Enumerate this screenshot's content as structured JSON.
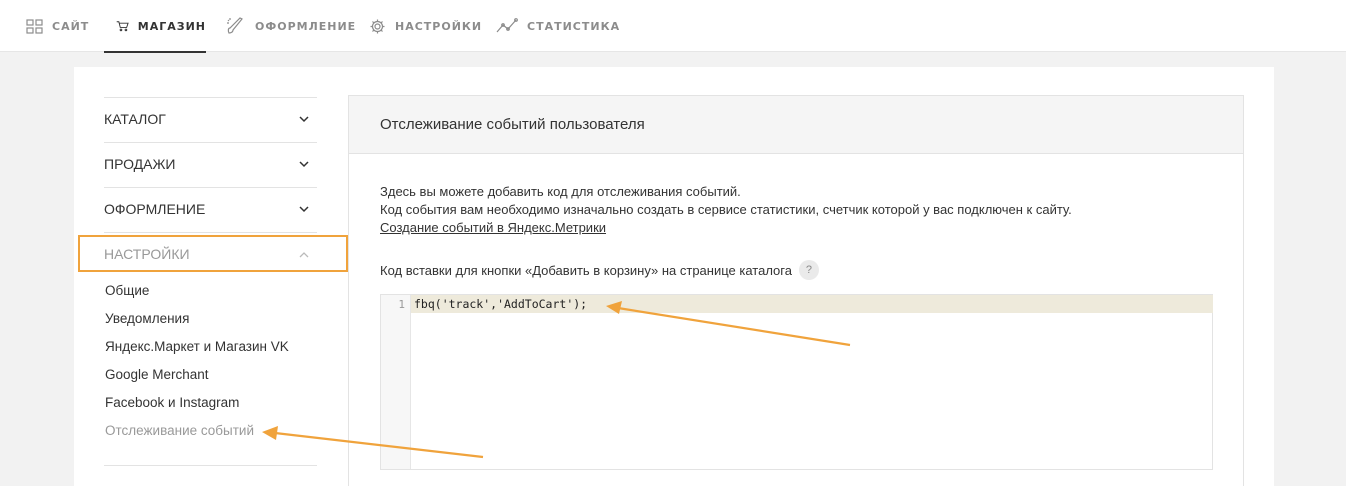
{
  "topnav": {
    "items": [
      {
        "label": "САЙТ",
        "icon": "grid-icon",
        "active": false
      },
      {
        "label": "МАГАЗИН",
        "icon": "cart-icon",
        "active": true
      },
      {
        "label": "ОФОРМЛЕНИЕ",
        "icon": "brush-icon",
        "active": false
      },
      {
        "label": "НАСТРОЙКИ",
        "icon": "gear-icon",
        "active": false
      },
      {
        "label": "СТАТИСТИКА",
        "icon": "chart-line-icon",
        "active": false
      }
    ]
  },
  "sidebar": {
    "sections": [
      {
        "label": "КАТАЛОГ",
        "expanded": false
      },
      {
        "label": "ПРОДАЖИ",
        "expanded": false
      },
      {
        "label": "ОФОРМЛЕНИЕ",
        "expanded": false
      },
      {
        "label": "НАСТРОЙКИ",
        "expanded": true
      }
    ],
    "subitems": [
      {
        "label": "Общие"
      },
      {
        "label": "Уведомления"
      },
      {
        "label": "Яндекс.Маркет и Магазин VK"
      },
      {
        "label": "Google Merchant"
      },
      {
        "label": "Facebook и Instagram"
      },
      {
        "label": "Отслеживание событий",
        "current": true
      }
    ]
  },
  "panel": {
    "title": "Отслеживание событий пользователя",
    "desc_line1": "Здесь вы можете добавить код для отслеживания событий.",
    "desc_line2": "Код события вам необходимо изначально создать в сервисе статистики, счетчик которой у вас подключен к сайту.",
    "desc_link": "Создание событий в Яндекс.Метрики",
    "code_label": "Код вставки для кнопки «Добавить в корзину» на странице каталога",
    "help": "?",
    "editor": {
      "line_number": "1",
      "code": "fbq('track','AddToCart');"
    }
  },
  "colors": {
    "accent": "#f0a33c",
    "active_line": "#eeeadb"
  }
}
